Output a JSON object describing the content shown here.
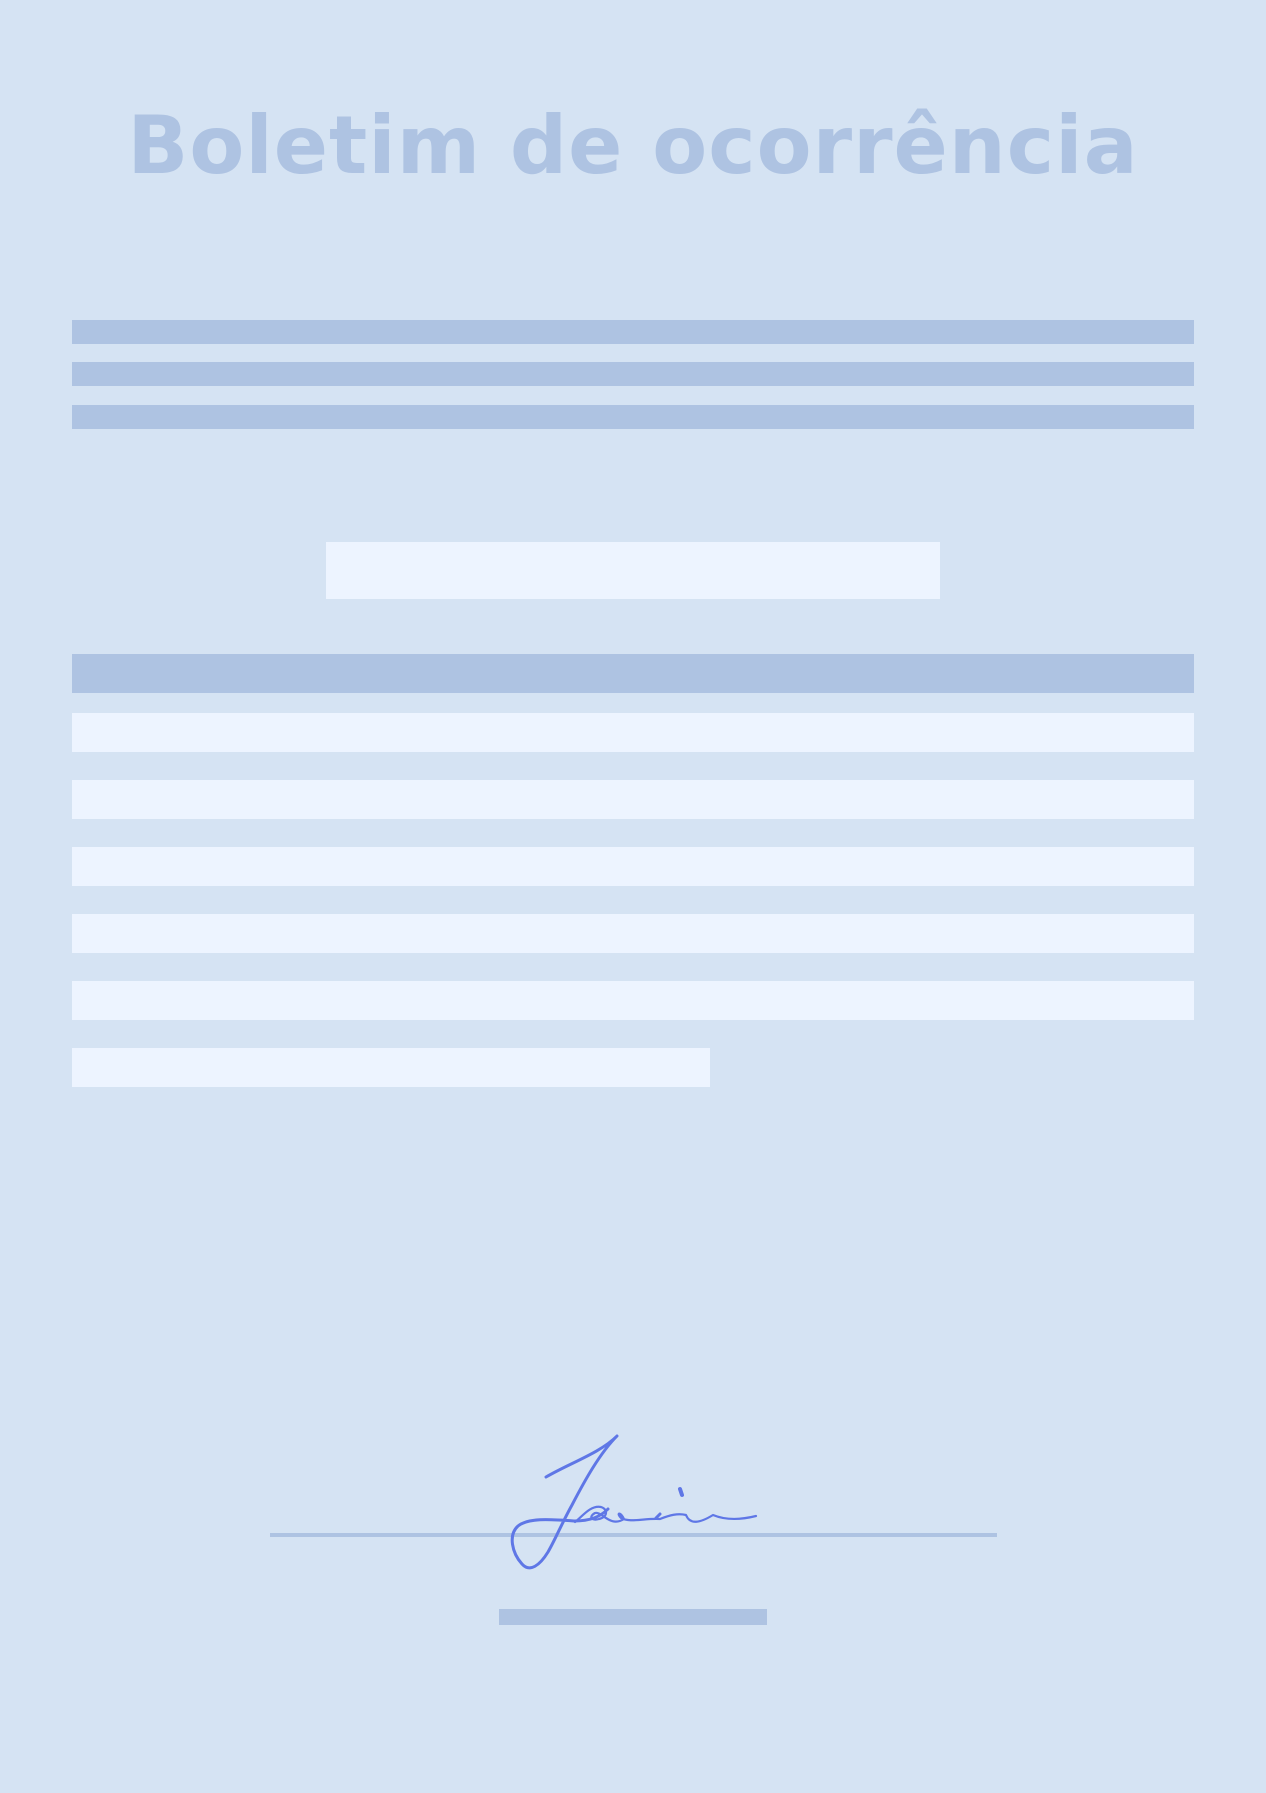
{
  "document": {
    "title": "Boletim de ocorrência"
  },
  "colors": {
    "background": "#d5e3f3",
    "title": "#aec3e2",
    "bar_dark": "#aec3e2",
    "bar_light": "#edf4ff",
    "signature_ink": "#5f77e6"
  },
  "signature": {
    "icon": "handwritten-signature"
  }
}
